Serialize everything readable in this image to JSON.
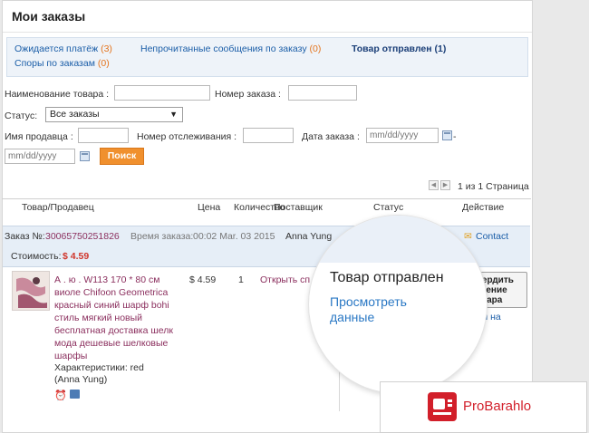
{
  "page": {
    "title": "Мои заказы"
  },
  "summary": {
    "awaiting_payment": {
      "label": "Ожидается платёж",
      "count": "(3)"
    },
    "unread_messages": {
      "label": "Непрочитанные сообщения по заказу",
      "count": "(0)"
    },
    "shipped": {
      "label": "Товар отправлен",
      "count": "(1)"
    },
    "disputes": {
      "label": "Споры по заказам",
      "count": "(0)"
    }
  },
  "filters": {
    "product_name_label": "Наименование товара :",
    "order_number_label": "Номер заказа :",
    "status_label": "Статус:",
    "status_value": "Все заказы",
    "seller_name_label": "Имя продавца :",
    "tracking_number_label": "Номер отслеживания :",
    "order_date_label": "Дата заказа :",
    "date_from_placeholder": "mm/dd/yyyy",
    "date_to_placeholder": "mm/dd/yyyy",
    "date_dash": "-",
    "search_button": "Поиск"
  },
  "pagination": {
    "text": "1 из 1 Страница"
  },
  "table": {
    "headers": [
      "Товар/Продавец",
      "Цена",
      "Количество",
      "Поставщик",
      "Статус",
      "Действие"
    ],
    "order": {
      "number_label": "Заказ №:",
      "number": "30065750251826",
      "time_label": "Время заказа:",
      "time": "00:02 Mar. 03 2015",
      "supplier": "Anna Yung",
      "contact": "Contact",
      "cost_label": "Стоимость:",
      "cost": "$ 4.59"
    },
    "item": {
      "title_lines": [
        "А . ю . W113 170 * 80 см",
        "виоле Chifoon Geometrica",
        "красный синий шарф bohi",
        "стиль мягкий новый",
        "бесплатная доставка шелк",
        "мода дешевые шелковые",
        "шарфы"
      ],
      "characteristics": "Характеристики: red",
      "seller": "(Anna Yung)",
      "price": "$ 4.59",
      "quantity": "1",
      "dispute_link": "Открыть сп"
    }
  },
  "magnifier": {
    "status": "Товар отправлен",
    "link_line1": "Просмотреть",
    "link_line2": "данные"
  },
  "action": {
    "confirm_line1": "твердить",
    "confirm_line2": "учение",
    "confirm_line3": "овара",
    "link_fragment1": "ться на",
    "link_fragment2": "om"
  },
  "watermark": {
    "text": "ProBarahlo"
  },
  "colors": {
    "orange": "#f0902e",
    "link": "#1b5ea8",
    "price_red": "#d0352b",
    "brand_red": "#d21f2a"
  }
}
